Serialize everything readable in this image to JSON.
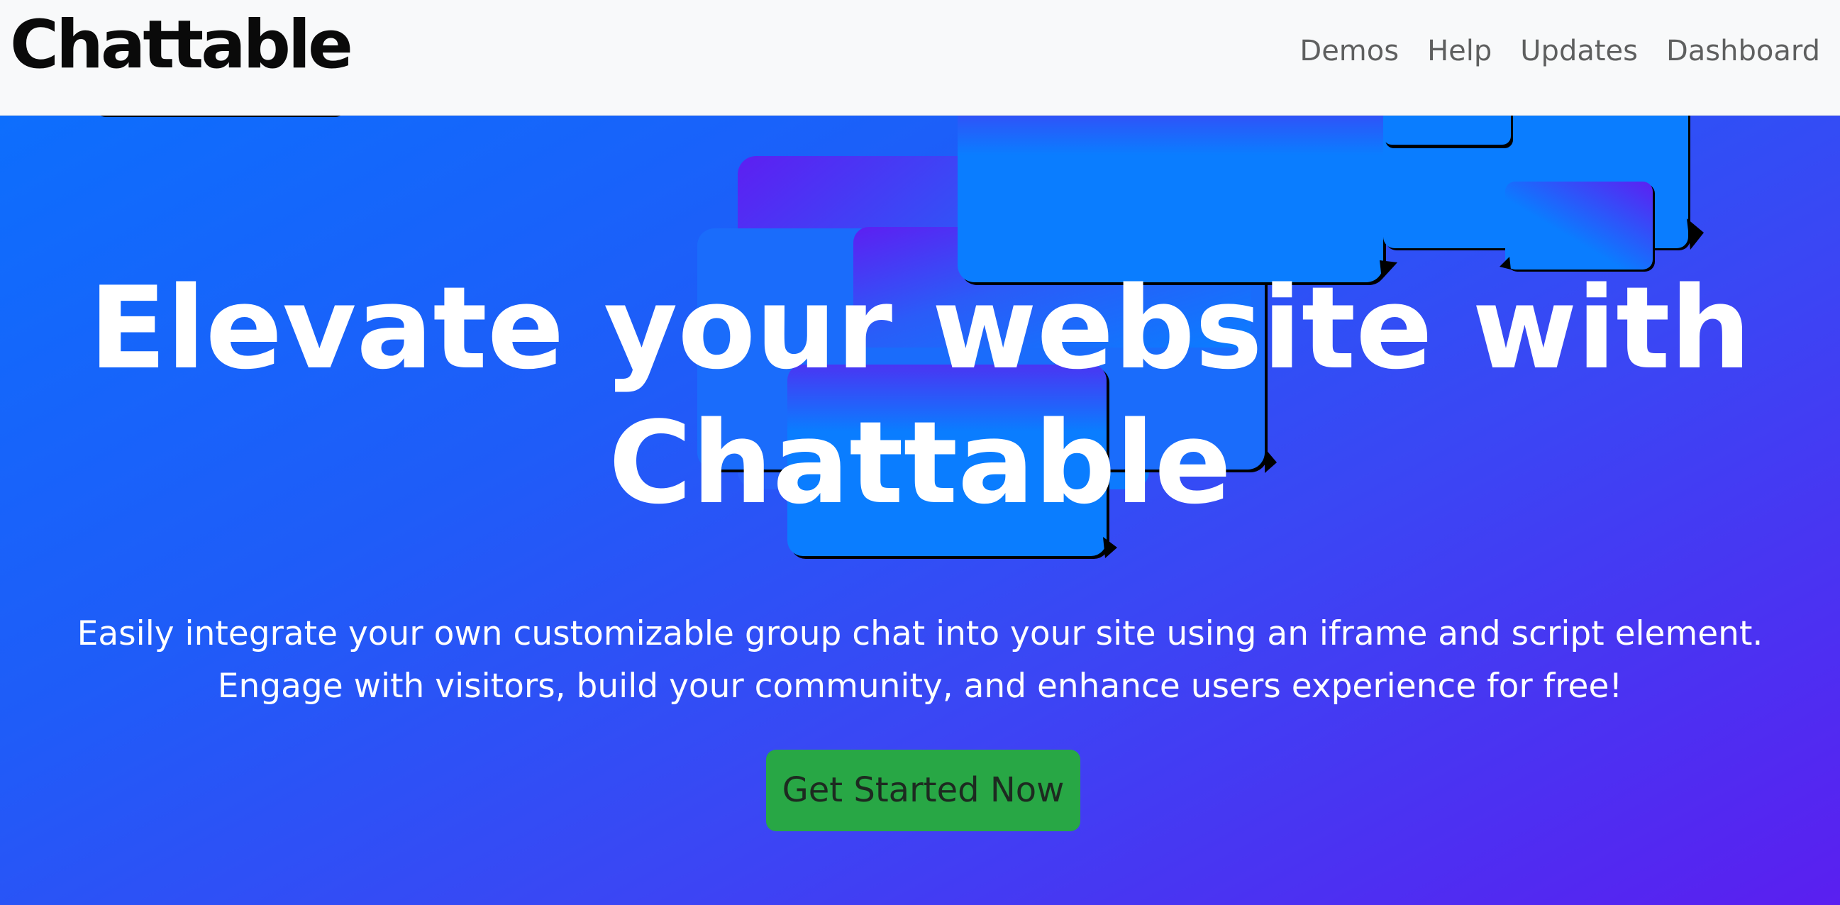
{
  "navbar": {
    "brand": "Chattable",
    "links": [
      "Demos",
      "Help",
      "Updates",
      "Dashboard"
    ]
  },
  "hero": {
    "title_line1": "Elevate your website with",
    "title_line2": "Chattable",
    "subtitle_line1": "Easily integrate your own customizable group chat into your site using an iframe and script element.",
    "subtitle_line2": "Engage with visitors, build your community, and enhance users experience for free!",
    "cta_label": "Get Started Now"
  },
  "colors": {
    "navbar_bg": "#f8f9fa",
    "hero_gradient_start": "#0d6efd",
    "hero_gradient_end": "#5a1ff0",
    "bubble_blue": "#0a7dff",
    "bubble_purple": "#5a1ff0",
    "cta_green": "#28a745"
  },
  "icons": {
    "decor": "chat-bubble-shapes"
  }
}
